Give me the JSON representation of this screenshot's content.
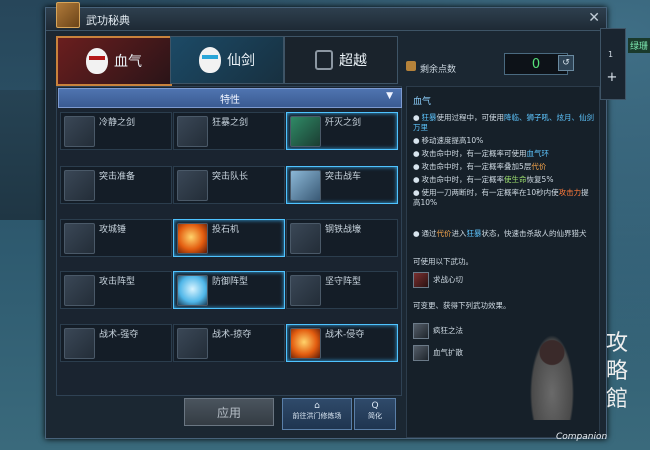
{
  "window": {
    "title": "武功秘典"
  },
  "tabs": [
    {
      "label": "血气",
      "icon": "red-mask-icon",
      "active": true
    },
    {
      "label": "仙剑",
      "icon": "blue-mask-icon",
      "active": false
    },
    {
      "label": "超越",
      "icon": "lock-icon",
      "active": false
    }
  ],
  "points": {
    "label": "剩余点数",
    "value": "0"
  },
  "filter": {
    "selected": "特性"
  },
  "skills": [
    {
      "name": "冷静之剑",
      "active": false
    },
    {
      "name": "狂暴之剑",
      "active": false
    },
    {
      "name": "歼灭之剑",
      "active": true
    },
    {
      "name": "突击准备",
      "active": false
    },
    {
      "name": "突击队长",
      "active": false
    },
    {
      "name": "突击战车",
      "active": true
    },
    {
      "name": "攻城锤",
      "active": false
    },
    {
      "name": "投石机",
      "active": true
    },
    {
      "name": "钢铁战壕",
      "active": false
    },
    {
      "name": "攻击阵型",
      "active": false
    },
    {
      "name": "防御阵型",
      "active": true
    },
    {
      "name": "坚守阵型",
      "active": false
    },
    {
      "name": "战术-强夺",
      "active": false
    },
    {
      "name": "战术-掠夺",
      "active": false
    },
    {
      "name": "战术-侵夺",
      "active": true
    }
  ],
  "buttons": {
    "apply": "应用",
    "training": "前往洪门修炼场",
    "simplify": "简化"
  },
  "detail": {
    "heading": "血气",
    "line1_a": "狂暴",
    "line1_b": "使用过程中，可使用",
    "line1_c": "降临、狮子吼、",
    "line1_d": "炫月、",
    "line1_e": "仙剑万里",
    "line2": "移动速度提高10%",
    "line3_a": "攻击命中时，有一定概率可使用",
    "line3_b": "血气环",
    "line4_a": "攻击命中时，有一定概率叠加5层",
    "line4_b": "代价",
    "line5_a": "攻击命中时，有一定概率",
    "line5_b": "使生命",
    "line5_c": "恢复5%",
    "line6_a": "使用一刀两断时，有一定概率在10秒内使",
    "line6_b": "攻击力",
    "line6_c": "提高10%",
    "line7_a": "通过",
    "line7_b": "代价",
    "line7_c": "进入",
    "line7_d": "狂暴",
    "line7_e": "状态，快速击杀敌人的仙界猎犬",
    "usable": "可使用以下武功。",
    "skill_a": "求战心切",
    "effects": "可变更、获得下列武功效果。",
    "skill_b": "疯狂之法",
    "skill_c": "血气扩散"
  },
  "side": {
    "count": "1",
    "add": "+",
    "map_label": "绿珊"
  },
  "watermark": "Companion",
  "calligraphy": "攻略館"
}
